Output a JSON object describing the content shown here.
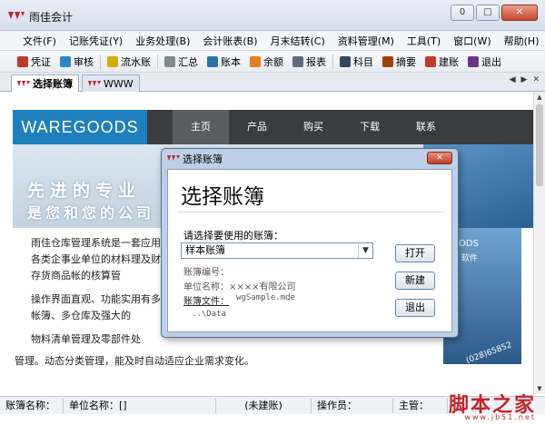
{
  "window": {
    "title": "雨佳会计",
    "minimize": "0",
    "maximize": "□",
    "close": "✕"
  },
  "menu": [
    "文件(F)",
    "记账凭证(Y)",
    "业务处理(B)",
    "会计账表(B)",
    "月末结转(C)",
    "资料管理(M)",
    "工具(T)",
    "窗口(W)",
    "帮助(H)"
  ],
  "toolbar": [
    {
      "label": "凭证",
      "icon": "voucher-icon",
      "color": "#c0392b"
    },
    {
      "label": "审核",
      "icon": "audit-icon",
      "color": "#2e86c1"
    },
    {
      "label": "流水账",
      "icon": "journal-icon",
      "color": "#d4ac0d"
    },
    {
      "label": "汇总",
      "icon": "summary-icon",
      "color": "#7f8c8d"
    },
    {
      "label": "账本",
      "icon": "ledger-icon",
      "color": "#2874a6"
    },
    {
      "label": "余额",
      "icon": "balance-icon",
      "color": "#e67e22"
    },
    {
      "label": "报表",
      "icon": "report-icon",
      "color": "#5d6d7e"
    },
    {
      "label": "科目",
      "icon": "account-icon",
      "color": "#34495e"
    },
    {
      "label": "摘要",
      "icon": "memo-icon",
      "color": "#a04000"
    },
    {
      "label": "建账",
      "icon": "create-ledger-icon",
      "color": "#c0392b"
    },
    {
      "label": "退出",
      "icon": "exit-icon",
      "color": "#6c3483"
    }
  ],
  "tabs": [
    {
      "label": "选择账簿",
      "active": true
    },
    {
      "label": "WWW",
      "active": false
    }
  ],
  "site": {
    "logo": "WAREGOODS",
    "nav": [
      "主页",
      "产品",
      "购买",
      "下载",
      "联系"
    ],
    "slogan1": "先进的专业",
    "slogan2": "是您和您的公司",
    "banner_text": "ODS",
    "banner_text2": "软件",
    "para1": "雨佳仓库管理系统是一套应用于各类企事业单位的材料理及财务存货商品帐的核算管",
    "para2": "操作界面直观、功能实用有多套帐簿、多仓库及强大的",
    "para3": "物料清单管理及零部件处",
    "para4": "管理。动态分类管理，能及时自动适应企业需求变化。",
    "phone": "(028)65852"
  },
  "dialog": {
    "title": "选择账簿",
    "heading": "选择账簿",
    "label": "请选择要使用的账簿：",
    "selected": "样本账簿",
    "id_label": "账簿编号：",
    "company": "单位名称：××××有限公司",
    "file_label": "账簿文件：",
    "file_value": "wgSample.mde",
    "path": "..\\Data",
    "btn_open": "打开",
    "btn_new": "新建",
    "btn_exit": "退出"
  },
  "status": {
    "ledger_name": "账簿名称：",
    "unit_name": "单位名称：[]",
    "created": "(未建账)",
    "operator": "操作员：",
    "supervisor": "主管："
  },
  "watermark": {
    "text": "脚本之家",
    "sub": "www.jb51.net"
  },
  "colors": {
    "accent": "#1f7fbd",
    "dialog_frame": "#bcd0e8",
    "close_red": "#c9452d",
    "logo_red": "#c0262c"
  }
}
